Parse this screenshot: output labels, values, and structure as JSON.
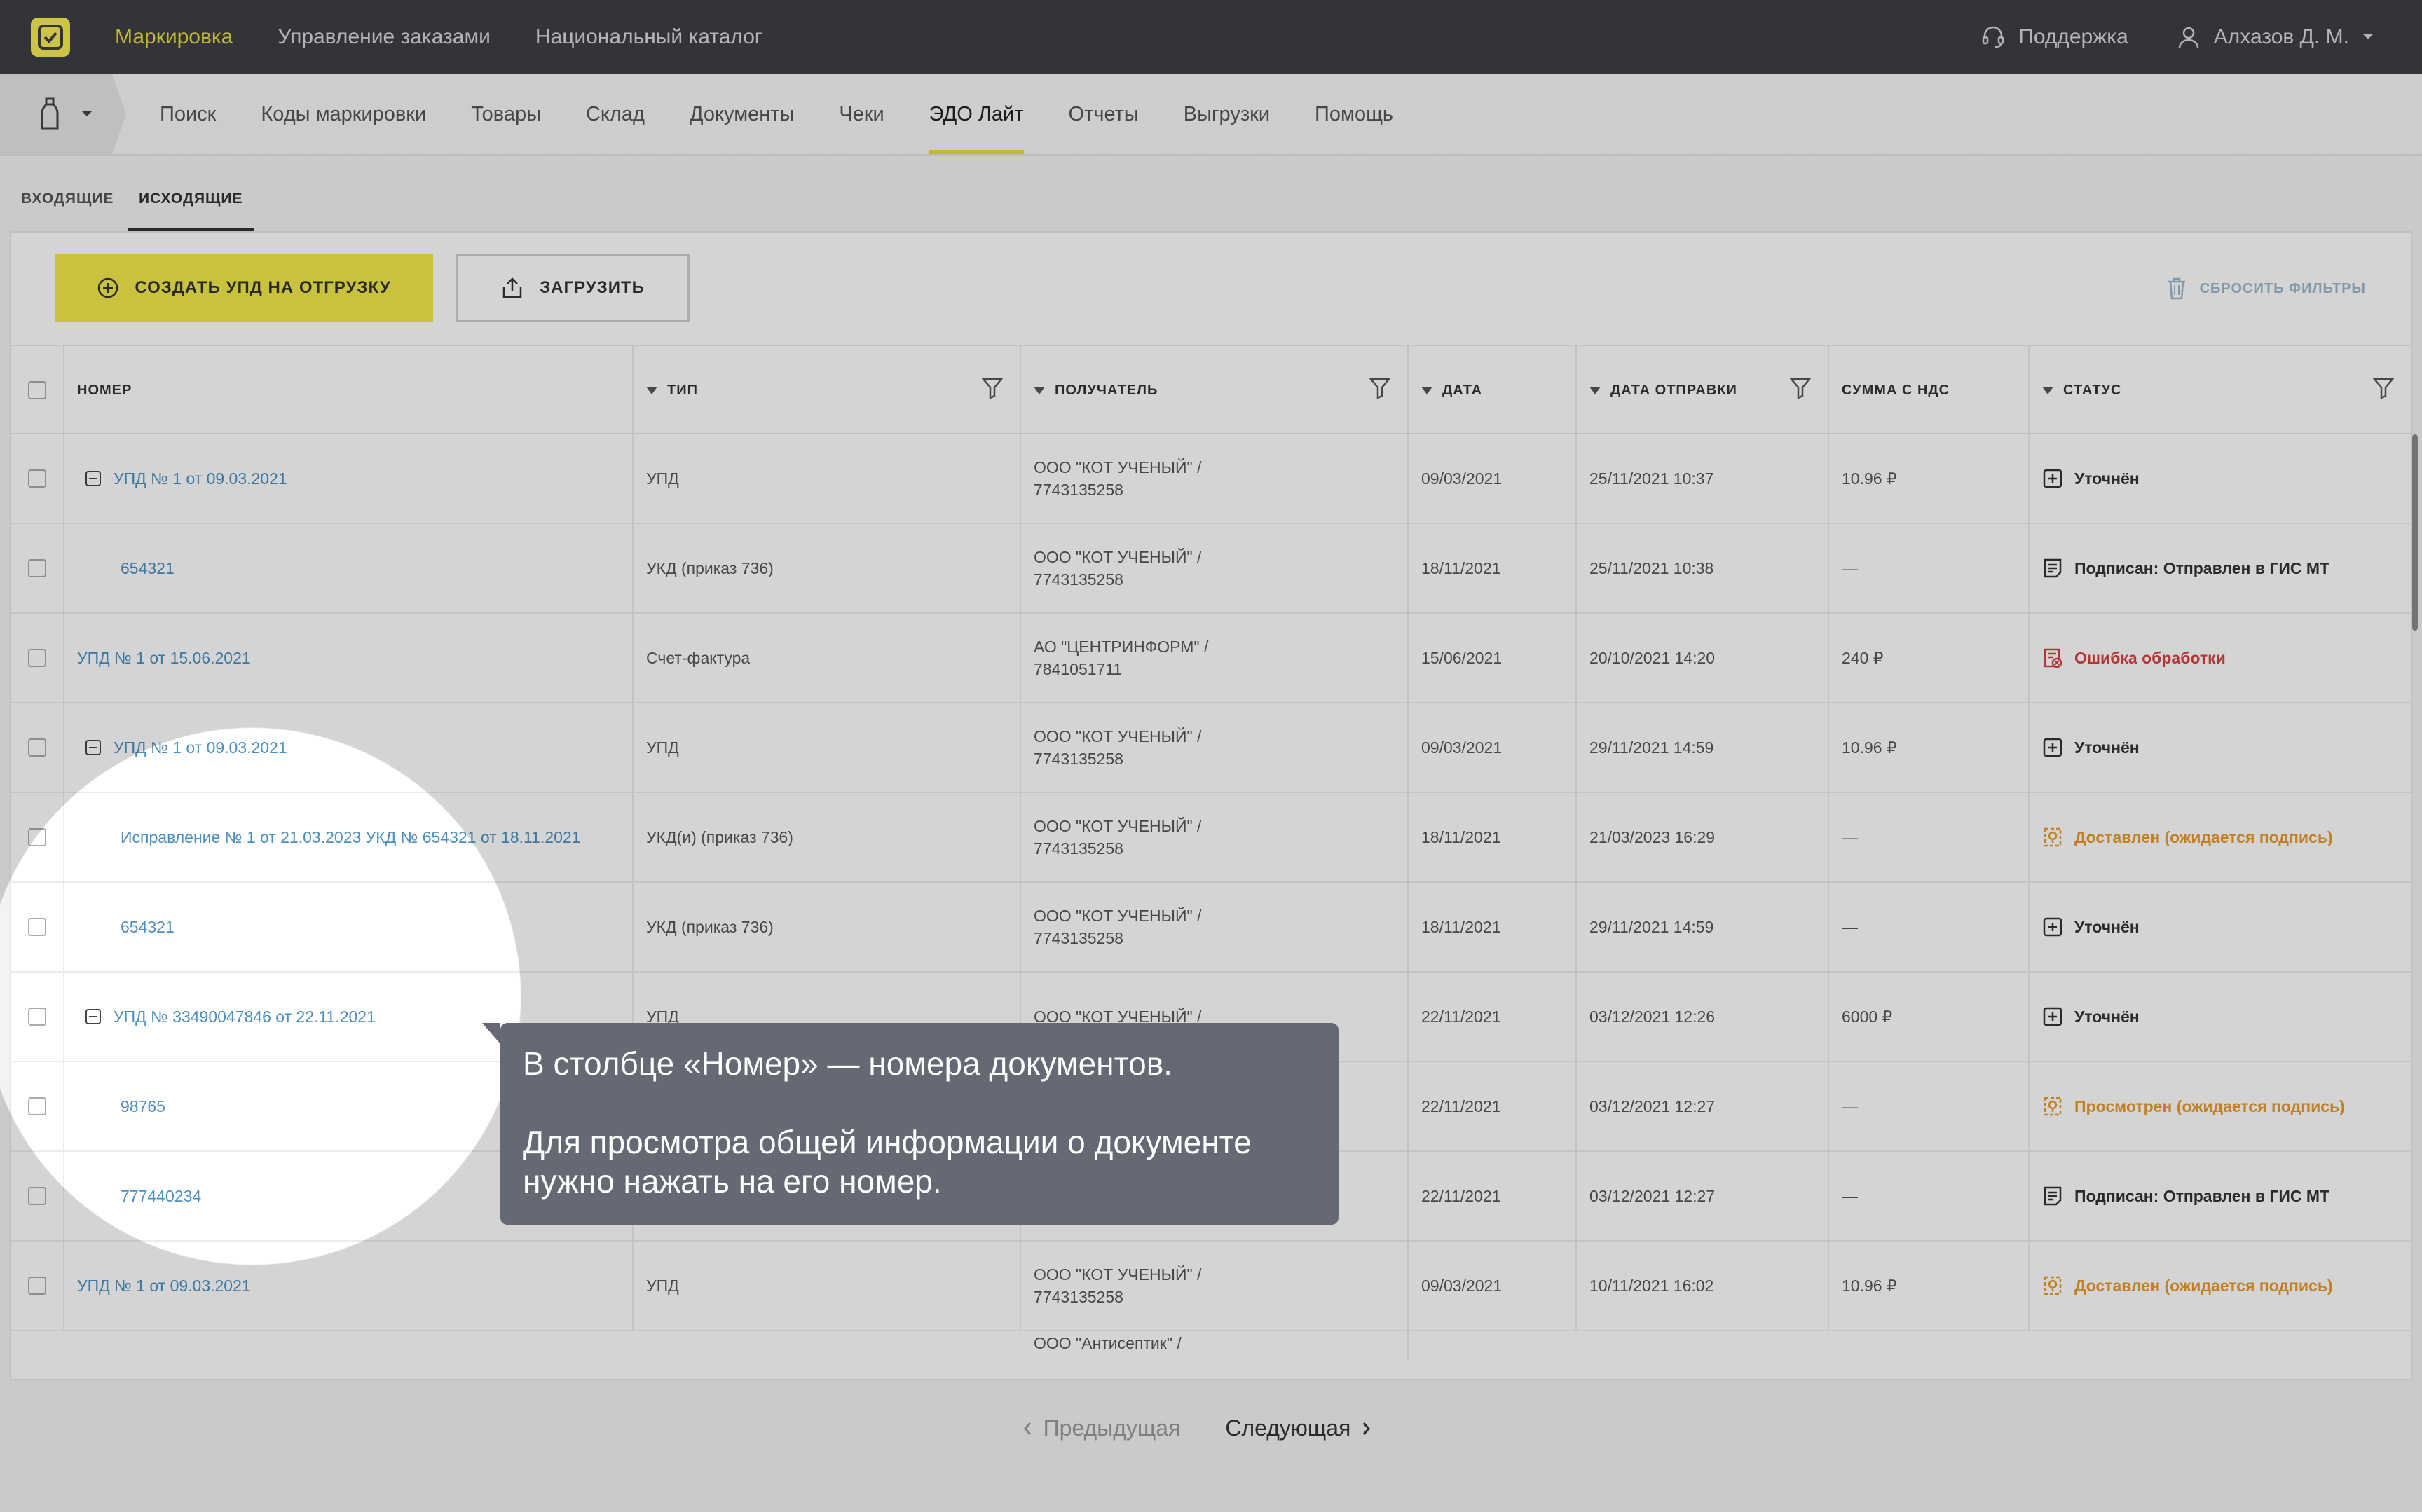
{
  "topbar": {
    "nav": [
      "Маркировка",
      "Управление заказами",
      "Национальный каталог"
    ],
    "support": "Поддержка",
    "user": "Алхазов Д. М."
  },
  "subnav": [
    "Поиск",
    "Коды маркировки",
    "Товары",
    "Склад",
    "Документы",
    "Чеки",
    "ЭДО Лайт",
    "Отчеты",
    "Выгрузки",
    "Помощь"
  ],
  "tabs": {
    "incoming": "ВХОДЯЩИЕ",
    "outgoing": "ИСХОДЯЩИЕ"
  },
  "toolbar": {
    "create": "СОЗДАТЬ УПД НА ОТГРУЗКУ",
    "upload": "ЗАГРУЗИТЬ",
    "reset": "СБРОСИТЬ ФИЛЬТРЫ"
  },
  "columns": {
    "number": "НОМЕР",
    "type": "ТИП",
    "recipient": "ПОЛУЧАТЕЛЬ",
    "date": "ДАТА",
    "sent": "ДАТА ОТПРАВКИ",
    "sum": "СУММА С НДС",
    "status": "СТАТУС"
  },
  "rows": [
    {
      "number": "УПД № 1 от 09.03.2021",
      "type": "УПД",
      "recipient1": "ООО \"КОТ УЧЕНЫЙ\" /",
      "recipient2": "7743135258",
      "date": "09/03/2021",
      "sent": "25/11/2021 10:37",
      "sum": "10.96 ₽",
      "status": "Уточнён"
    },
    {
      "number": "654321",
      "type": "УКД (приказ 736)",
      "recipient1": "ООО \"КОТ УЧЕНЫЙ\" /",
      "recipient2": "7743135258",
      "date": "18/11/2021",
      "sent": "25/11/2021 10:38",
      "sum": "—",
      "status": "Подписан: Отправлен в ГИС МТ"
    },
    {
      "number": "УПД № 1 от 15.06.2021",
      "type": "Счет-фактура",
      "recipient1": "АО \"ЦЕНТРИНФОРМ\" /",
      "recipient2": "7841051711",
      "date": "15/06/2021",
      "sent": "20/10/2021 14:20",
      "sum": "240 ₽",
      "status": "Ошибка обработки"
    },
    {
      "number": "УПД № 1 от 09.03.2021",
      "type": "УПД",
      "recipient1": "ООО \"КОТ УЧЕНЫЙ\" /",
      "recipient2": "7743135258",
      "date": "09/03/2021",
      "sent": "29/11/2021 14:59",
      "sum": "10.96 ₽",
      "status": "Уточнён"
    },
    {
      "number": "Исправление № 1 от 21.03.2023 УКД № 654321 от 18.11.2021",
      "type": "УКД(и) (приказ 736)",
      "recipient1": "ООО \"КОТ УЧЕНЫЙ\" /",
      "recipient2": "7743135258",
      "date": "18/11/2021",
      "sent": "21/03/2023 16:29",
      "sum": "—",
      "status": "Доставлен (ожидается подпись)"
    },
    {
      "number": "654321",
      "type": "УКД (приказ 736)",
      "recipient1": "ООО \"КОТ УЧЕНЫЙ\" /",
      "recipient2": "7743135258",
      "date": "18/11/2021",
      "sent": "29/11/2021 14:59",
      "sum": "—",
      "status": "Уточнён"
    },
    {
      "number": "УПД № 33490047846 от 22.11.2021",
      "type": "УПД",
      "recipient1": "ООО \"КОТ УЧЕНЫЙ\" /",
      "recipient2": "",
      "date": "22/11/2021",
      "sent": "03/12/2021 12:26",
      "sum": "6000 ₽",
      "status": "Уточнён"
    },
    {
      "number": "98765",
      "type": "",
      "recipient1": "",
      "recipient2": "",
      "date": "22/11/2021",
      "sent": "03/12/2021 12:27",
      "sum": "—",
      "status": "Просмотрен (ожидается подпись)"
    },
    {
      "number": "777440234",
      "type": "",
      "recipient1": "",
      "recipient2": "",
      "date": "22/11/2021",
      "sent": "03/12/2021 12:27",
      "sum": "—",
      "status": "Подписан: Отправлен в ГИС МТ"
    },
    {
      "number": "УПД № 1 от 09.03.2021",
      "type": "УПД",
      "recipient1": "ООО \"КОТ УЧЕНЫЙ\" /",
      "recipient2": "7743135258",
      "date": "09/03/2021",
      "sent": "10/11/2021 16:02",
      "sum": "10.96 ₽",
      "status": "Доставлен (ожидается подпись)"
    }
  ],
  "partial_row": {
    "recipient": "ООО \"Антисептик\" /"
  },
  "pager": {
    "prev": "Предыдущая",
    "next": "Следующая"
  },
  "tooltip": {
    "line1": "В столбце «Номер» — номера документов.",
    "line2": "Для просмотра общей информации о документе",
    "line3": "нужно нажать на его номер."
  },
  "colors": {
    "accent": "#f2e94a",
    "link": "#4a8fbf",
    "error": "#d94040",
    "warning": "#e89a2a",
    "topbar": "#3d3f45"
  }
}
